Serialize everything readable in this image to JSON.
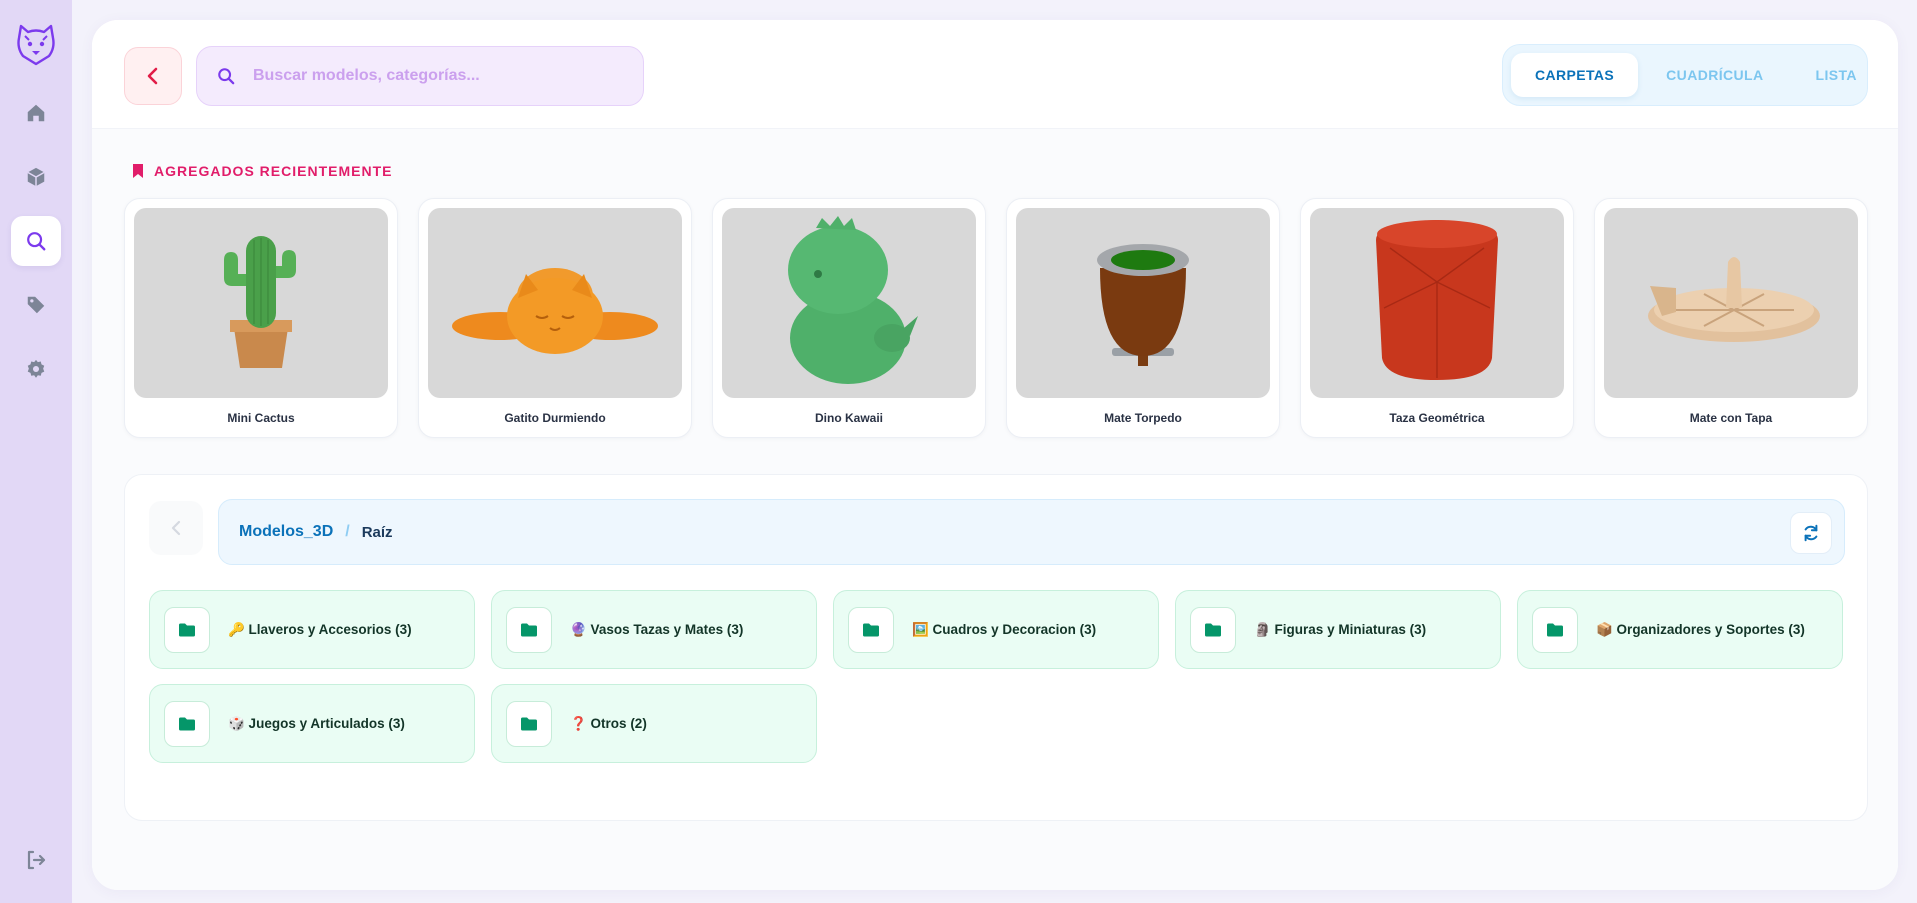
{
  "search": {
    "placeholder": "Buscar modelos, categorías..."
  },
  "view_toggle": [
    {
      "label": "CARPETAS",
      "active": true
    },
    {
      "label": "CUADRÍCULA",
      "active": false
    },
    {
      "label": "LISTA",
      "active": false
    }
  ],
  "recent": {
    "title": "AGREGADOS RECIENTEMENTE",
    "items": [
      {
        "name": "Mini Cactus"
      },
      {
        "name": "Gatito Durmiendo"
      },
      {
        "name": "Dino Kawaii"
      },
      {
        "name": "Mate Torpedo"
      },
      {
        "name": "Taza Geométrica"
      },
      {
        "name": "Mate con Tapa"
      }
    ]
  },
  "explorer": {
    "breadcrumb_root": "Modelos_3D",
    "breadcrumb_sep": "/",
    "breadcrumb_current": "Raíz",
    "folders": [
      {
        "label": "🔑 Llaveros y Accesorios (3)"
      },
      {
        "label": "🔮 Vasos Tazas y Mates (3)"
      },
      {
        "label": "🖼️ Cuadros y Decoracion (3)"
      },
      {
        "label": "🗿 Figuras y Miniaturas (3)"
      },
      {
        "label": "📦 Organizadores y Soportes (3)"
      },
      {
        "label": "🎲 Juegos y Articulados (3)"
      },
      {
        "label": "❓ Otros (2)"
      }
    ]
  },
  "colors": {
    "sidebar_bg": "#e2d8f6",
    "accent_purple": "#7c3aed",
    "accent_pink": "#e11d6a",
    "accent_blue": "#0b72b9",
    "folder_green": "#059669"
  },
  "icons": {
    "logo": "bear-logo-icon",
    "nav": [
      "home-icon",
      "cube-icon",
      "search-icon",
      "tag-icon",
      "gear-icon"
    ],
    "logout": "logout-icon",
    "back": "chevron-left-icon",
    "refresh": "refresh-icon",
    "folder": "folder-icon",
    "bookmark": "bookmark-icon"
  }
}
